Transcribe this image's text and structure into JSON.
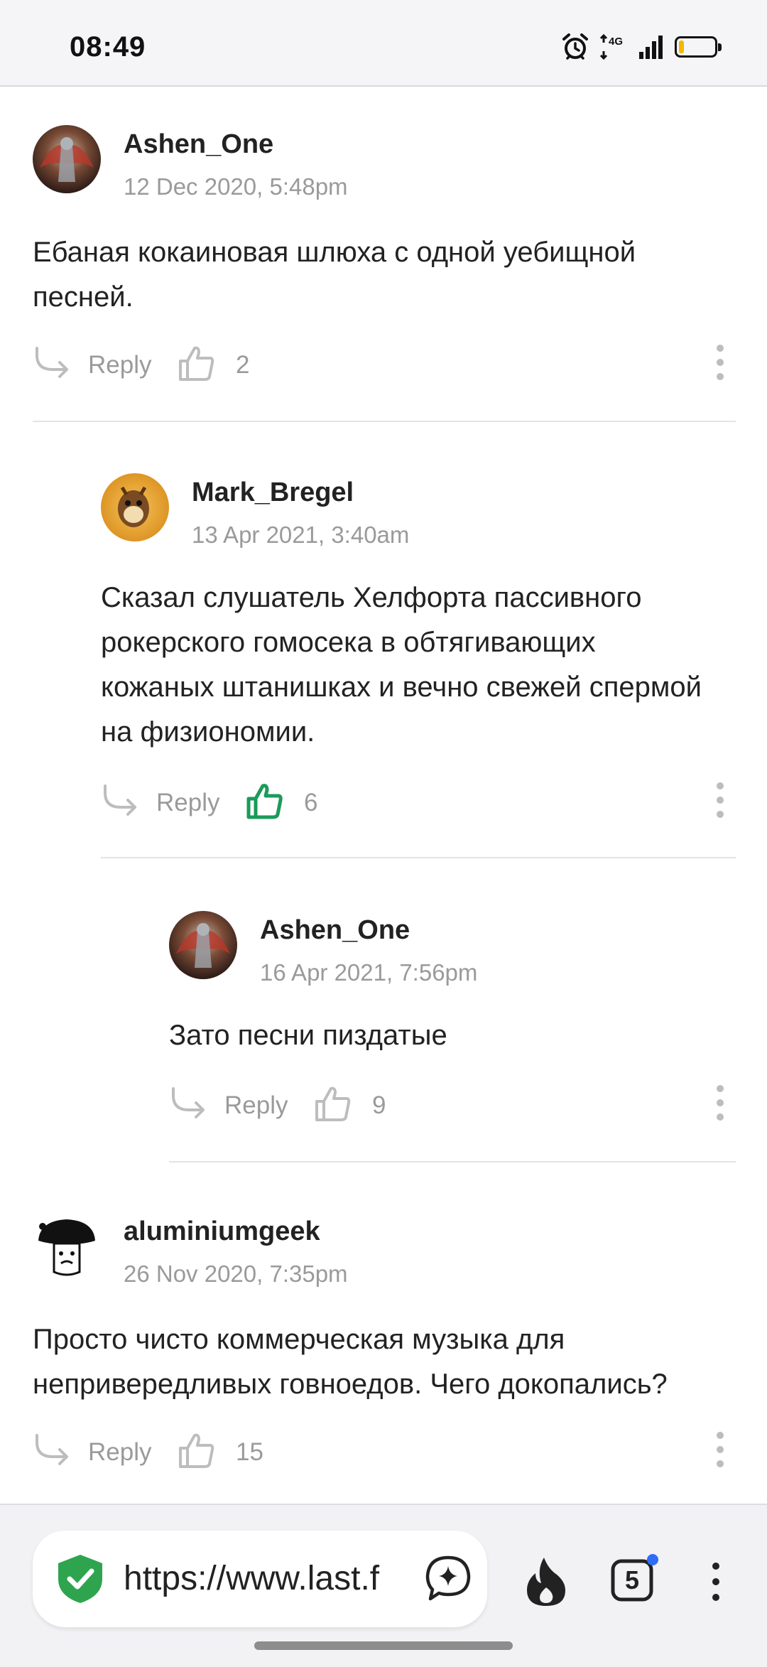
{
  "status_bar": {
    "time": "08:49",
    "network": "4G",
    "battery_level": 0.15,
    "icons": [
      "alarm-icon",
      "network-icon",
      "signal-icon",
      "battery-icon"
    ]
  },
  "comments": [
    {
      "username": "Ashen_One",
      "date": "12 Dec 2020, 5:48pm",
      "text": "Ебаная кокаиновая шлюха с одной уебищной песней.",
      "reply_label": "Reply",
      "likes": "2",
      "liked": false
    },
    {
      "username": "Mark_Bregel",
      "date": "13 Apr 2021, 3:40am",
      "text": "Сказал слушатель Хелфорта пассивного рокерского гомосека в обтягивающих кожаных штанишках и вечно свежей спермой на физиономии.",
      "reply_label": "Reply",
      "likes": "6",
      "liked": true
    },
    {
      "username": "Ashen_One",
      "date": "16 Apr 2021, 7:56pm",
      "text": "Зато песни пиздатые",
      "reply_label": "Reply",
      "likes": "9",
      "liked": false
    },
    {
      "username": "aluminiumgeek",
      "date": "26 Nov 2020, 7:35pm",
      "text": "Просто чисто коммерческая музыка для непривередливых говноедов. Чего докопались?",
      "reply_label": "Reply",
      "likes": "15",
      "liked": false
    }
  ],
  "browser": {
    "url": "https://www.last.f",
    "tab_count": "5"
  },
  "colors": {
    "liked": "#1a9b5a",
    "muted": "#9a9a9a",
    "shield": "#2ea44f",
    "battery": "#f2b800",
    "notification_dot": "#2f6df6"
  }
}
